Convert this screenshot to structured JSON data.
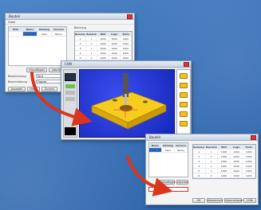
{
  "window1": {
    "title": "Bauteil",
    "menu": "Datei",
    "list_header": [
      "Bild",
      "Name",
      "Katalog",
      "Version"
    ],
    "list_row": [
      "",
      "Frame_DIN_Ho",
      "Aktiv",
      "Name"
    ],
    "group_title": "Bohrung",
    "table_header": [
      "Nummer",
      "Bezeichnung",
      "Bild",
      "Lage",
      "Tiefe"
    ],
    "table_rows": [
      [
        "1",
        "1",
        "1000",
        "1000",
        "1000"
      ],
      [
        "2",
        "1",
        "1000",
        "1000",
        "1000"
      ],
      [
        "3",
        "1",
        "1000",
        "1000",
        "1000"
      ],
      [
        "4",
        "1",
        "1000",
        "1000",
        "1000"
      ],
      [
        "5",
        "1",
        "1000",
        "1000",
        "1000"
      ],
      [
        "6",
        "1",
        "1000",
        "1000",
        "1000"
      ]
    ],
    "label_a": "Bezeichnung",
    "value_a": "Nr.0",
    "label_b": "Beschreibung",
    "value_b": "Frame",
    "btn_left": "Hinzufügen",
    "btn_mid": "Löschen",
    "tab1": "Auswahl",
    "tab2": "Hinzu",
    "tab3": "Zurück",
    "opt1": "Kontrolle",
    "opt2": "Anzeigen"
  },
  "window2": {
    "title": "CAM"
  },
  "window3": {
    "title": "Bauteil",
    "list_header": [
      "Bild",
      "Name",
      "Katalog",
      "Version"
    ],
    "list_row": [
      "",
      "Frame_DIN_Ho",
      "Aktiv",
      "Name"
    ],
    "table_header": [
      "Nummer",
      "Bezeichnung",
      "Bild",
      "Lage",
      "Tiefe"
    ],
    "table_rows": [
      [
        "1",
        "1",
        "1000",
        "1000",
        "1000"
      ],
      [
        "2",
        "1",
        "1000",
        "1000",
        "1000"
      ],
      [
        "3",
        "1",
        "1000",
        "1000",
        "1000"
      ],
      [
        "4",
        "1",
        "1000",
        "1000",
        "1000"
      ],
      [
        "5",
        "1",
        "1000",
        "1000",
        "1000"
      ],
      [
        "6",
        "1",
        "1000",
        "1000",
        "1000"
      ]
    ],
    "btn_left": "Hinzufügen",
    "btn_mid": "Löschen",
    "ok": "OK",
    "cancel": "Abbrechen",
    "apply": "Übernehmen",
    "help": "Hilfe"
  },
  "colors": {
    "accent": "#d9361c",
    "part": "#f3c21a",
    "viewport": "#1d2fd0"
  }
}
